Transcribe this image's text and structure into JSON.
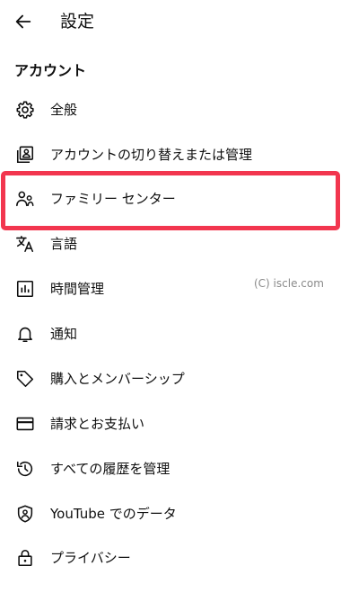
{
  "header": {
    "back_icon": "arrow-left-icon",
    "title": "設定"
  },
  "section": {
    "title": "アカウント"
  },
  "items": [
    {
      "label": "全般",
      "icon": "gear-icon"
    },
    {
      "label": "アカウントの切り替えまたは管理",
      "icon": "account-switch-icon"
    },
    {
      "label": "ファミリー センター",
      "icon": "family-icon"
    },
    {
      "label": "言語",
      "icon": "translate-icon"
    },
    {
      "label": "時間管理",
      "icon": "bar-chart-icon"
    },
    {
      "label": "通知",
      "icon": "bell-icon"
    },
    {
      "label": "購入とメンバーシップ",
      "icon": "tag-icon"
    },
    {
      "label": "請求とお支払い",
      "icon": "credit-card-icon"
    },
    {
      "label": "すべての履歴を管理",
      "icon": "history-icon"
    },
    {
      "label": "YouTube でのデータ",
      "icon": "shield-person-icon"
    },
    {
      "label": "プライバシー",
      "icon": "lock-icon"
    }
  ],
  "watermark": "(C) iscle.com",
  "colors": {
    "highlight": "#f2364f",
    "text": "#0f0f0f",
    "watermark": "#8a8a8a"
  }
}
